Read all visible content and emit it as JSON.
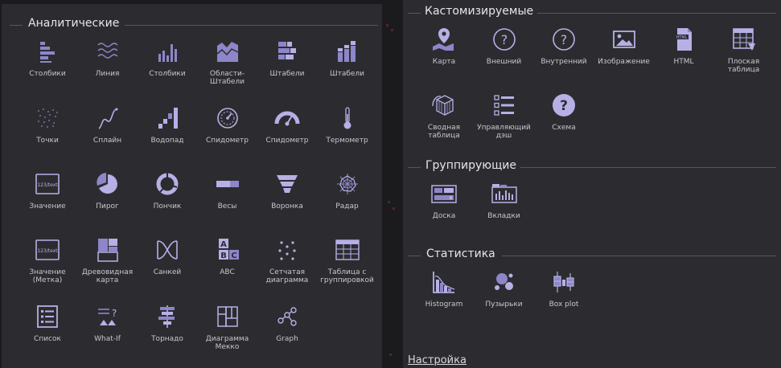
{
  "colors": {
    "icon": "#8d86c9",
    "icon_light": "#b6b0e6",
    "panel": "#2c2c30",
    "page": "#1b1b1d"
  },
  "analytic": {
    "title": "Аналитические",
    "rows": [
      [
        {
          "label": "Столбики",
          "icon": "hbar-chart-icon"
        },
        {
          "label": "Линия",
          "icon": "line-chart-icon"
        },
        {
          "label": "Столбики",
          "icon": "vbar-chart-icon"
        },
        {
          "label": "Области-\nШтабели",
          "icon": "stacked-area-icon"
        },
        {
          "label": "Штабели",
          "icon": "stacked-hbar-icon"
        },
        {
          "label": "Штабели",
          "icon": "stacked-vbar-icon"
        }
      ],
      [
        {
          "label": "Точки",
          "icon": "scatter-icon"
        },
        {
          "label": "Сплайн",
          "icon": "spline-icon"
        },
        {
          "label": "Водопад",
          "icon": "waterfall-icon"
        },
        {
          "label": "Спидометр",
          "icon": "gauge-outline-icon"
        },
        {
          "label": "Спидометр",
          "icon": "gauge-solid-icon"
        },
        {
          "label": "Термометр",
          "icon": "thermometer-icon"
        }
      ],
      [
        {
          "label": "Значение",
          "icon": "value-card-icon",
          "text": "123/text"
        },
        {
          "label": "Пирог",
          "icon": "pie-icon"
        },
        {
          "label": "Пончик",
          "icon": "donut-icon"
        },
        {
          "label": "Весы",
          "icon": "bullet-icon"
        },
        {
          "label": "Воронка",
          "icon": "funnel-icon"
        },
        {
          "label": "Радар",
          "icon": "radar-icon"
        }
      ],
      [
        {
          "label": "Значение\n(Метка)",
          "icon": "value-label-icon",
          "text": "123/text"
        },
        {
          "label": "Древовидная\nкарта",
          "icon": "treemap-icon"
        },
        {
          "label": "Санкей",
          "icon": "sankey-icon"
        },
        {
          "label": "ABC",
          "icon": "abc-icon",
          "letters": [
            "A",
            "B",
            "C"
          ]
        },
        {
          "label": "Сетчатая\nдиаграмма",
          "icon": "dot-grid-icon"
        },
        {
          "label": "Таблица с\nгруппировкой",
          "icon": "grouped-table-icon"
        }
      ],
      [
        {
          "label": "Список",
          "icon": "list-icon"
        },
        {
          "label": "What-If",
          "icon": "what-if-icon"
        },
        {
          "label": "Торнадо",
          "icon": "tornado-icon"
        },
        {
          "label": "Диаграмма\nМекко",
          "icon": "mekko-icon"
        },
        {
          "label": "Graph",
          "icon": "graph-icon"
        }
      ]
    ]
  },
  "custom": {
    "title": "Кастомизируемые",
    "rows": [
      [
        {
          "label": "Карта",
          "icon": "map-pin-icon"
        },
        {
          "label": "Внешний",
          "icon": "question-circle-icon"
        },
        {
          "label": "Внутренний",
          "icon": "question-circle-icon"
        },
        {
          "label": "Изображение",
          "icon": "image-icon"
        },
        {
          "label": "HTML",
          "icon": "html-file-icon",
          "text": "HTML"
        },
        {
          "label": "Плоская\nтаблица",
          "icon": "flat-table-icon"
        }
      ],
      [
        {
          "label": "Сводная\nтаблица",
          "icon": "pivot-cube-icon"
        },
        {
          "label": "Управляющий\nдэш",
          "icon": "control-dash-icon"
        },
        {
          "label": "Схема",
          "icon": "question-filled-icon"
        }
      ]
    ]
  },
  "grouping": {
    "title": "Группирующие",
    "items": [
      {
        "label": "Доска",
        "icon": "board-icon"
      },
      {
        "label": "Вкладки",
        "icon": "tabs-icon"
      }
    ]
  },
  "statistics": {
    "title": "Статистика",
    "items": [
      {
        "label": "Histogram",
        "icon": "histogram-icon"
      },
      {
        "label": "Пузырьки",
        "icon": "bubbles-icon"
      },
      {
        "label": "Box plot",
        "icon": "box-plot-icon"
      }
    ]
  },
  "settings": {
    "label": "Настройка"
  }
}
